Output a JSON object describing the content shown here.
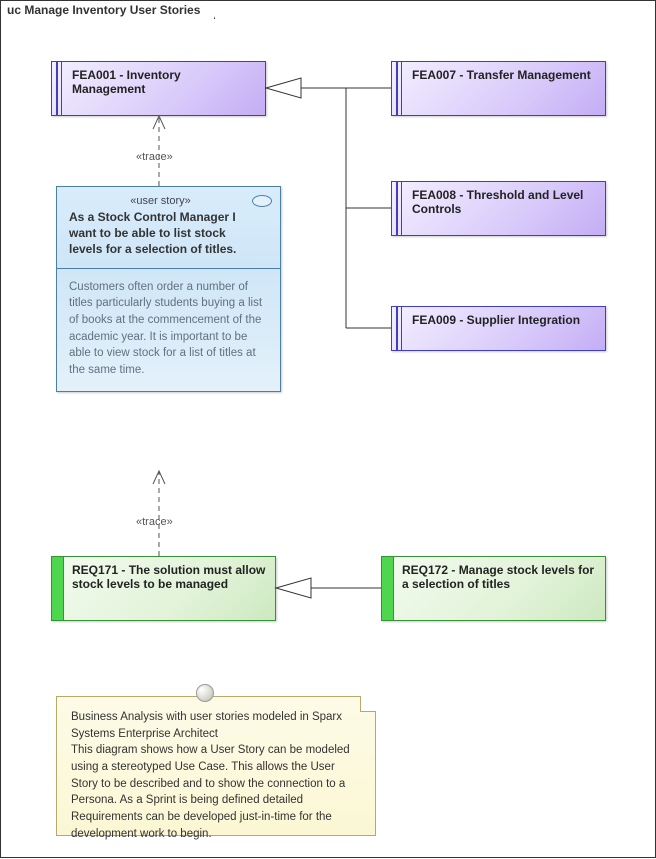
{
  "frame_title": "uc Manage Inventory User Stories",
  "features": {
    "fea001": "FEA001 - Inventory Management",
    "fea007": "FEA007 - Transfer Management",
    "fea008": "FEA008 - Threshold and Level Controls",
    "fea009": "FEA009 - Supplier Integration"
  },
  "story": {
    "stereotype": "«user story»",
    "title": "As a Stock Control Manager I want to be able to list stock levels for a selection of titles.",
    "body": "Customers often order a number of titles particularly students buying a list of books at the commencement of the academic year. It is important to be able to view stock for a list of titles at the same time."
  },
  "requirements": {
    "req171": "REQ171 - The solution must allow stock levels to be managed",
    "req172": "REQ172 - Manage stock levels for a selection of titles"
  },
  "trace_label_1": "«trace»",
  "trace_label_2": "«trace»",
  "note": {
    "line1": "Business Analysis with user stories modeled in Sparx Systems Enterprise Architect",
    "line2": "This diagram shows how a User Story can be modeled using a stereotyped Use Case. This allows the User Story to be described and to show the connection to a Persona. As a Sprint is being defined detailed Requirements can be developed just-in-time for the development work to begin."
  }
}
